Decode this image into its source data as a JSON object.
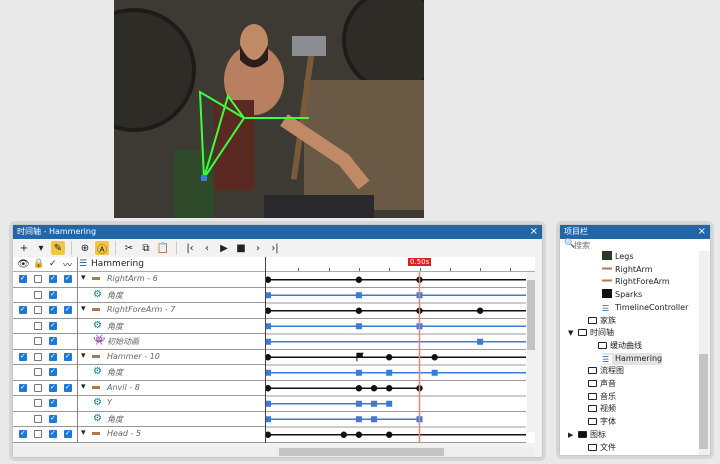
{
  "timeline": {
    "title": "时间轴 - Hammering",
    "close": "×",
    "sequence_name": "Hammering",
    "playhead_label": "0.50s",
    "playhead_time": 0.5,
    "toolbar": [
      "+",
      "▾",
      "✎",
      "⊕",
      "Ⓐ",
      "✂",
      "⧉",
      "📋",
      "|‹",
      "‹",
      "▶",
      "■",
      "›",
      "›|"
    ],
    "header_icons": [
      "eye-icon",
      "lock-icon",
      "check-icon",
      "curve-icon"
    ],
    "rows": [
      {
        "label": "RightArm - 6",
        "type": "object",
        "v": true,
        "l": false,
        "c": true,
        "g": true,
        "keys": [
          0,
          0.3,
          0.5
        ],
        "end": null
      },
      {
        "label": "角度",
        "type": "property",
        "l": false,
        "c": true,
        "keys": [
          0,
          0.3,
          0.5
        ],
        "end": null
      },
      {
        "label": "RightForeArm - 7",
        "type": "object",
        "v": true,
        "l": false,
        "c": true,
        "g": true,
        "keys": [
          0,
          0.3,
          0.5,
          0.7
        ],
        "end": null
      },
      {
        "label": "角度",
        "type": "property",
        "l": false,
        "c": true,
        "keys": [
          0,
          0.3,
          0.5
        ],
        "end": null
      },
      {
        "label": "初始动画",
        "type": "anim",
        "l": false,
        "c": true,
        "keys": [
          0,
          0.7
        ],
        "end": null
      },
      {
        "label": "Hammer - 10",
        "type": "object",
        "v": true,
        "l": false,
        "c": true,
        "g": true,
        "keys": [
          0,
          0.4,
          0.55
        ],
        "flag": 0.3,
        "end": null
      },
      {
        "label": "角度",
        "type": "property",
        "l": false,
        "c": true,
        "keys": [
          0,
          0.3,
          0.4,
          0.55
        ],
        "end": null
      },
      {
        "label": "Anvil - 8",
        "type": "object",
        "v": true,
        "l": false,
        "c": true,
        "g": true,
        "keys": [
          0,
          0.3,
          0.35,
          0.4,
          0.5
        ],
        "end": 0.5
      },
      {
        "label": "Y",
        "type": "property",
        "l": false,
        "c": true,
        "keys": [
          0,
          0.3,
          0.35,
          0.4
        ],
        "end": 0.4
      },
      {
        "label": "角度",
        "type": "property",
        "l": false,
        "c": true,
        "keys": [
          0,
          0.3,
          0.35,
          0.5
        ],
        "end": 0.5
      },
      {
        "label": "Head - 5",
        "type": "object",
        "v": true,
        "l": false,
        "c": true,
        "g": true,
        "keys": [
          0,
          0.25,
          0.3,
          0.4
        ],
        "end": null
      }
    ]
  },
  "project": {
    "title": "项目栏",
    "close": "×",
    "search_placeholder": "搜索",
    "items": [
      {
        "label": "Legs",
        "indent": 3,
        "icon": "legs"
      },
      {
        "label": "RightArm",
        "indent": 3,
        "icon": "arm"
      },
      {
        "label": "RightForeArm",
        "indent": 3,
        "icon": "arm"
      },
      {
        "label": "Sparks",
        "indent": 3,
        "icon": "sparks"
      },
      {
        "label": "TimelineController",
        "indent": 3,
        "icon": "timeline"
      },
      {
        "label": "家族",
        "indent": 2,
        "icon": "folder"
      },
      {
        "label": "时间轴",
        "indent": 1,
        "icon": "folder",
        "expanded": true
      },
      {
        "label": "缓动曲线",
        "indent": 3,
        "icon": "folder"
      },
      {
        "label": "Hammering",
        "indent": 3,
        "icon": "timeline",
        "selected": true
      },
      {
        "label": "流程图",
        "indent": 2,
        "icon": "folder"
      },
      {
        "label": "声音",
        "indent": 2,
        "icon": "folder"
      },
      {
        "label": "音乐",
        "indent": 2,
        "icon": "folder"
      },
      {
        "label": "视频",
        "indent": 2,
        "icon": "folder"
      },
      {
        "label": "字体",
        "indent": 2,
        "icon": "folder"
      },
      {
        "label": "图标",
        "indent": 1,
        "icon": "folder-filled",
        "collapsed": true
      },
      {
        "label": "文件",
        "indent": 2,
        "icon": "folder"
      }
    ]
  },
  "colors": {
    "accent": "#2266a8",
    "key_blue": "#3a7bd5",
    "playhead": "#e02020"
  }
}
